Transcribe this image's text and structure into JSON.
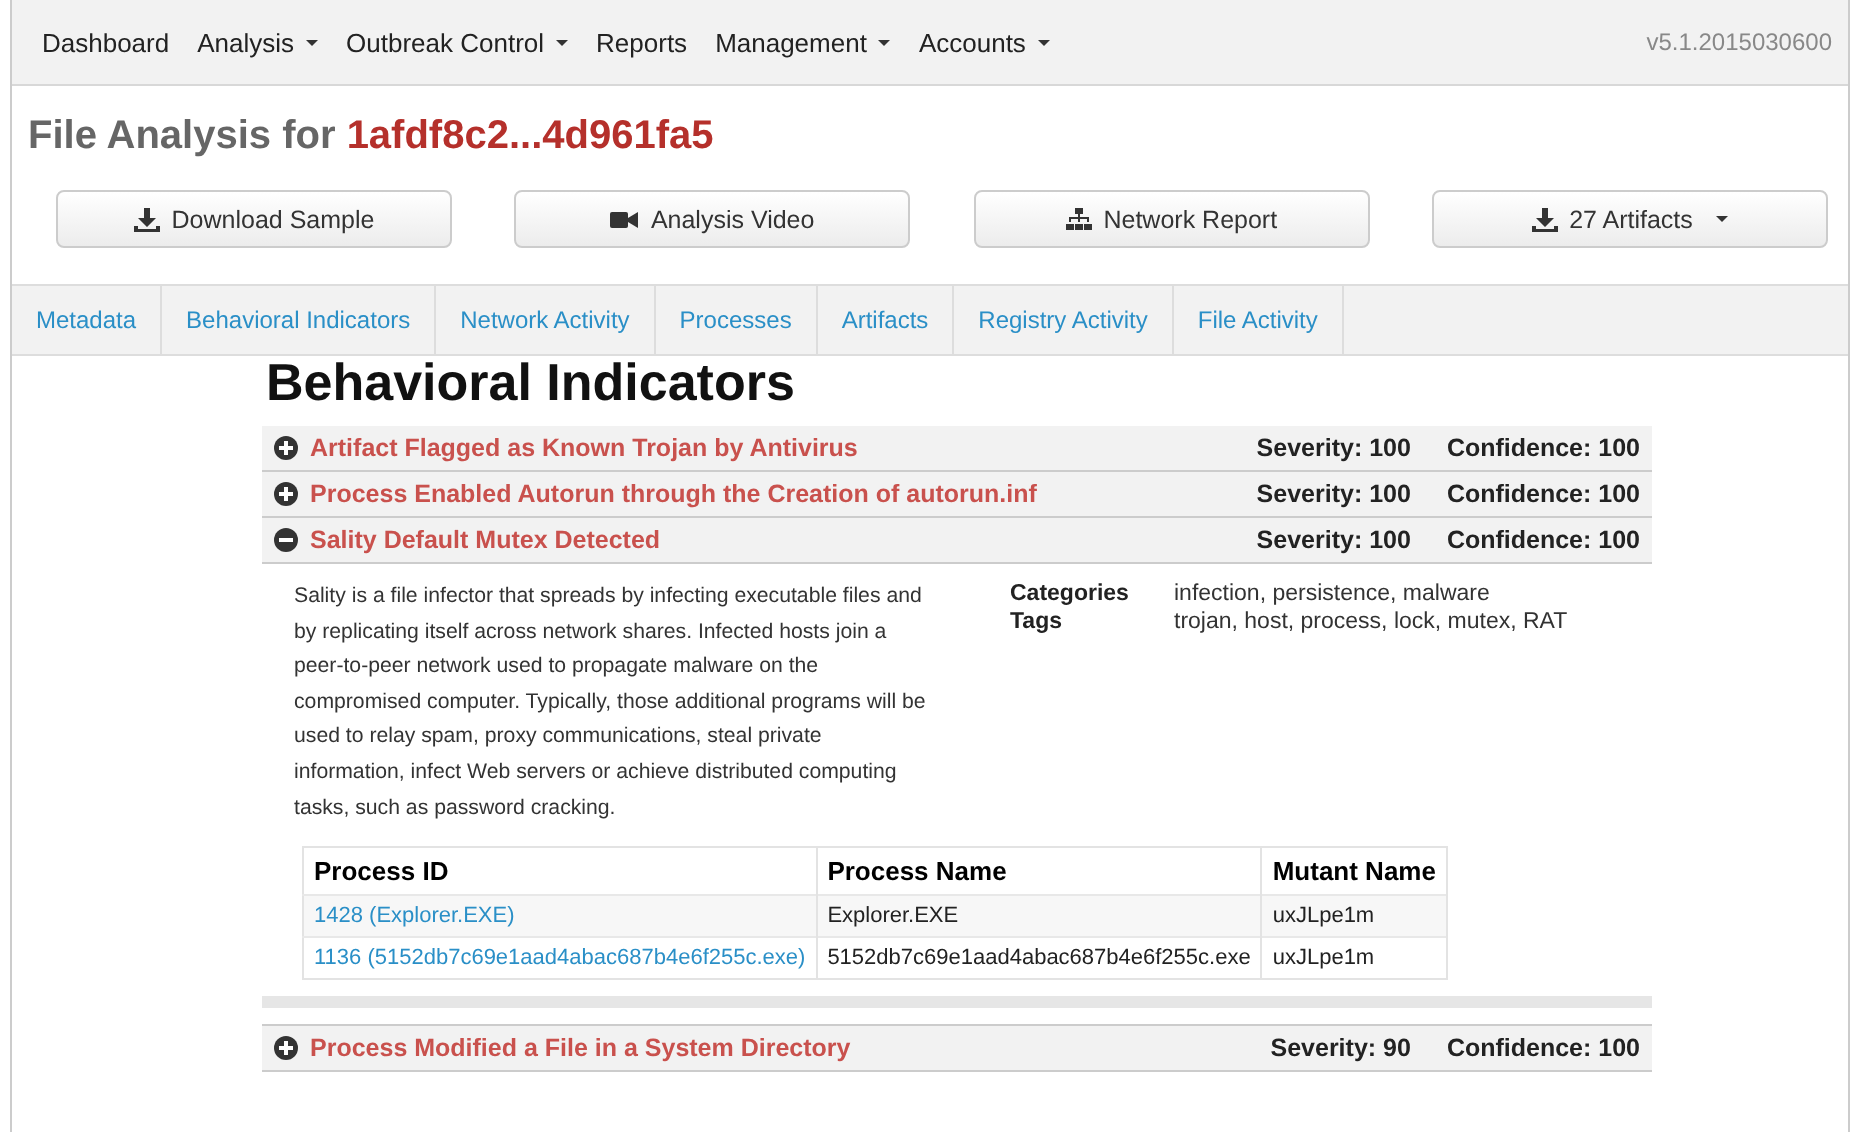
{
  "nav": {
    "items": [
      {
        "label": "Dashboard",
        "dropdown": false
      },
      {
        "label": "Analysis",
        "dropdown": true
      },
      {
        "label": "Outbreak Control",
        "dropdown": true
      },
      {
        "label": "Reports",
        "dropdown": false
      },
      {
        "label": "Management",
        "dropdown": true
      },
      {
        "label": "Accounts",
        "dropdown": true
      }
    ],
    "version": "v5.1.2015030600"
  },
  "title": {
    "prefix": "File Analysis for",
    "hash": "1afdf8c2...4d961fa5"
  },
  "buttons": [
    {
      "label": "Download Sample",
      "dropdown": false
    },
    {
      "label": "Analysis Video",
      "dropdown": false
    },
    {
      "label": "Network Report",
      "dropdown": false
    },
    {
      "label": "27 Artifacts",
      "dropdown": true
    }
  ],
  "tabs": [
    "Metadata",
    "Behavioral Indicators",
    "Network Activity",
    "Processes",
    "Artifacts",
    "Registry Activity",
    "File Activity"
  ],
  "heading": "Behavioral Indicators",
  "indicators": [
    {
      "title": "Artifact Flagged as Known Trojan by Antivirus",
      "severity": "Severity: 100",
      "confidence": "Confidence: 100",
      "expanded": false
    },
    {
      "title": "Process Enabled Autorun through the Creation of autorun.inf",
      "severity": "Severity: 100",
      "confidence": "Confidence: 100",
      "expanded": false
    },
    {
      "title": "Sality Default Mutex Detected",
      "severity": "Severity: 100",
      "confidence": "Confidence: 100",
      "expanded": true,
      "description": "Sality is a file infector that spreads by infecting executable files and by replicating itself across network shares. Infected hosts join a peer-to-peer network used to propagate malware on the compromised computer. Typically, those additional programs will be used to relay spam, proxy communications, steal private information, infect Web servers or achieve distributed computing tasks, such as password cracking.",
      "meta": [
        {
          "label": "Categories",
          "value": "infection, persistence, malware"
        },
        {
          "label": "Tags",
          "value": "trojan, host, process, lock, mutex, RAT"
        }
      ],
      "table": {
        "columns": [
          "Process ID",
          "Process Name",
          "Mutant Name"
        ],
        "rows": [
          [
            "1428 (Explorer.EXE)",
            "Explorer.EXE",
            "uxJLpe1m"
          ],
          [
            "1136 (5152db7c69e1aad4abac687b4e6f255c.exe)",
            "5152db7c69e1aad4abac687b4e6f255c.exe",
            "uxJLpe1m"
          ]
        ]
      }
    },
    {
      "title": "Process Modified a File in a System Directory",
      "severity": "Severity: 90",
      "confidence": "Confidence: 100",
      "expanded": false
    }
  ]
}
